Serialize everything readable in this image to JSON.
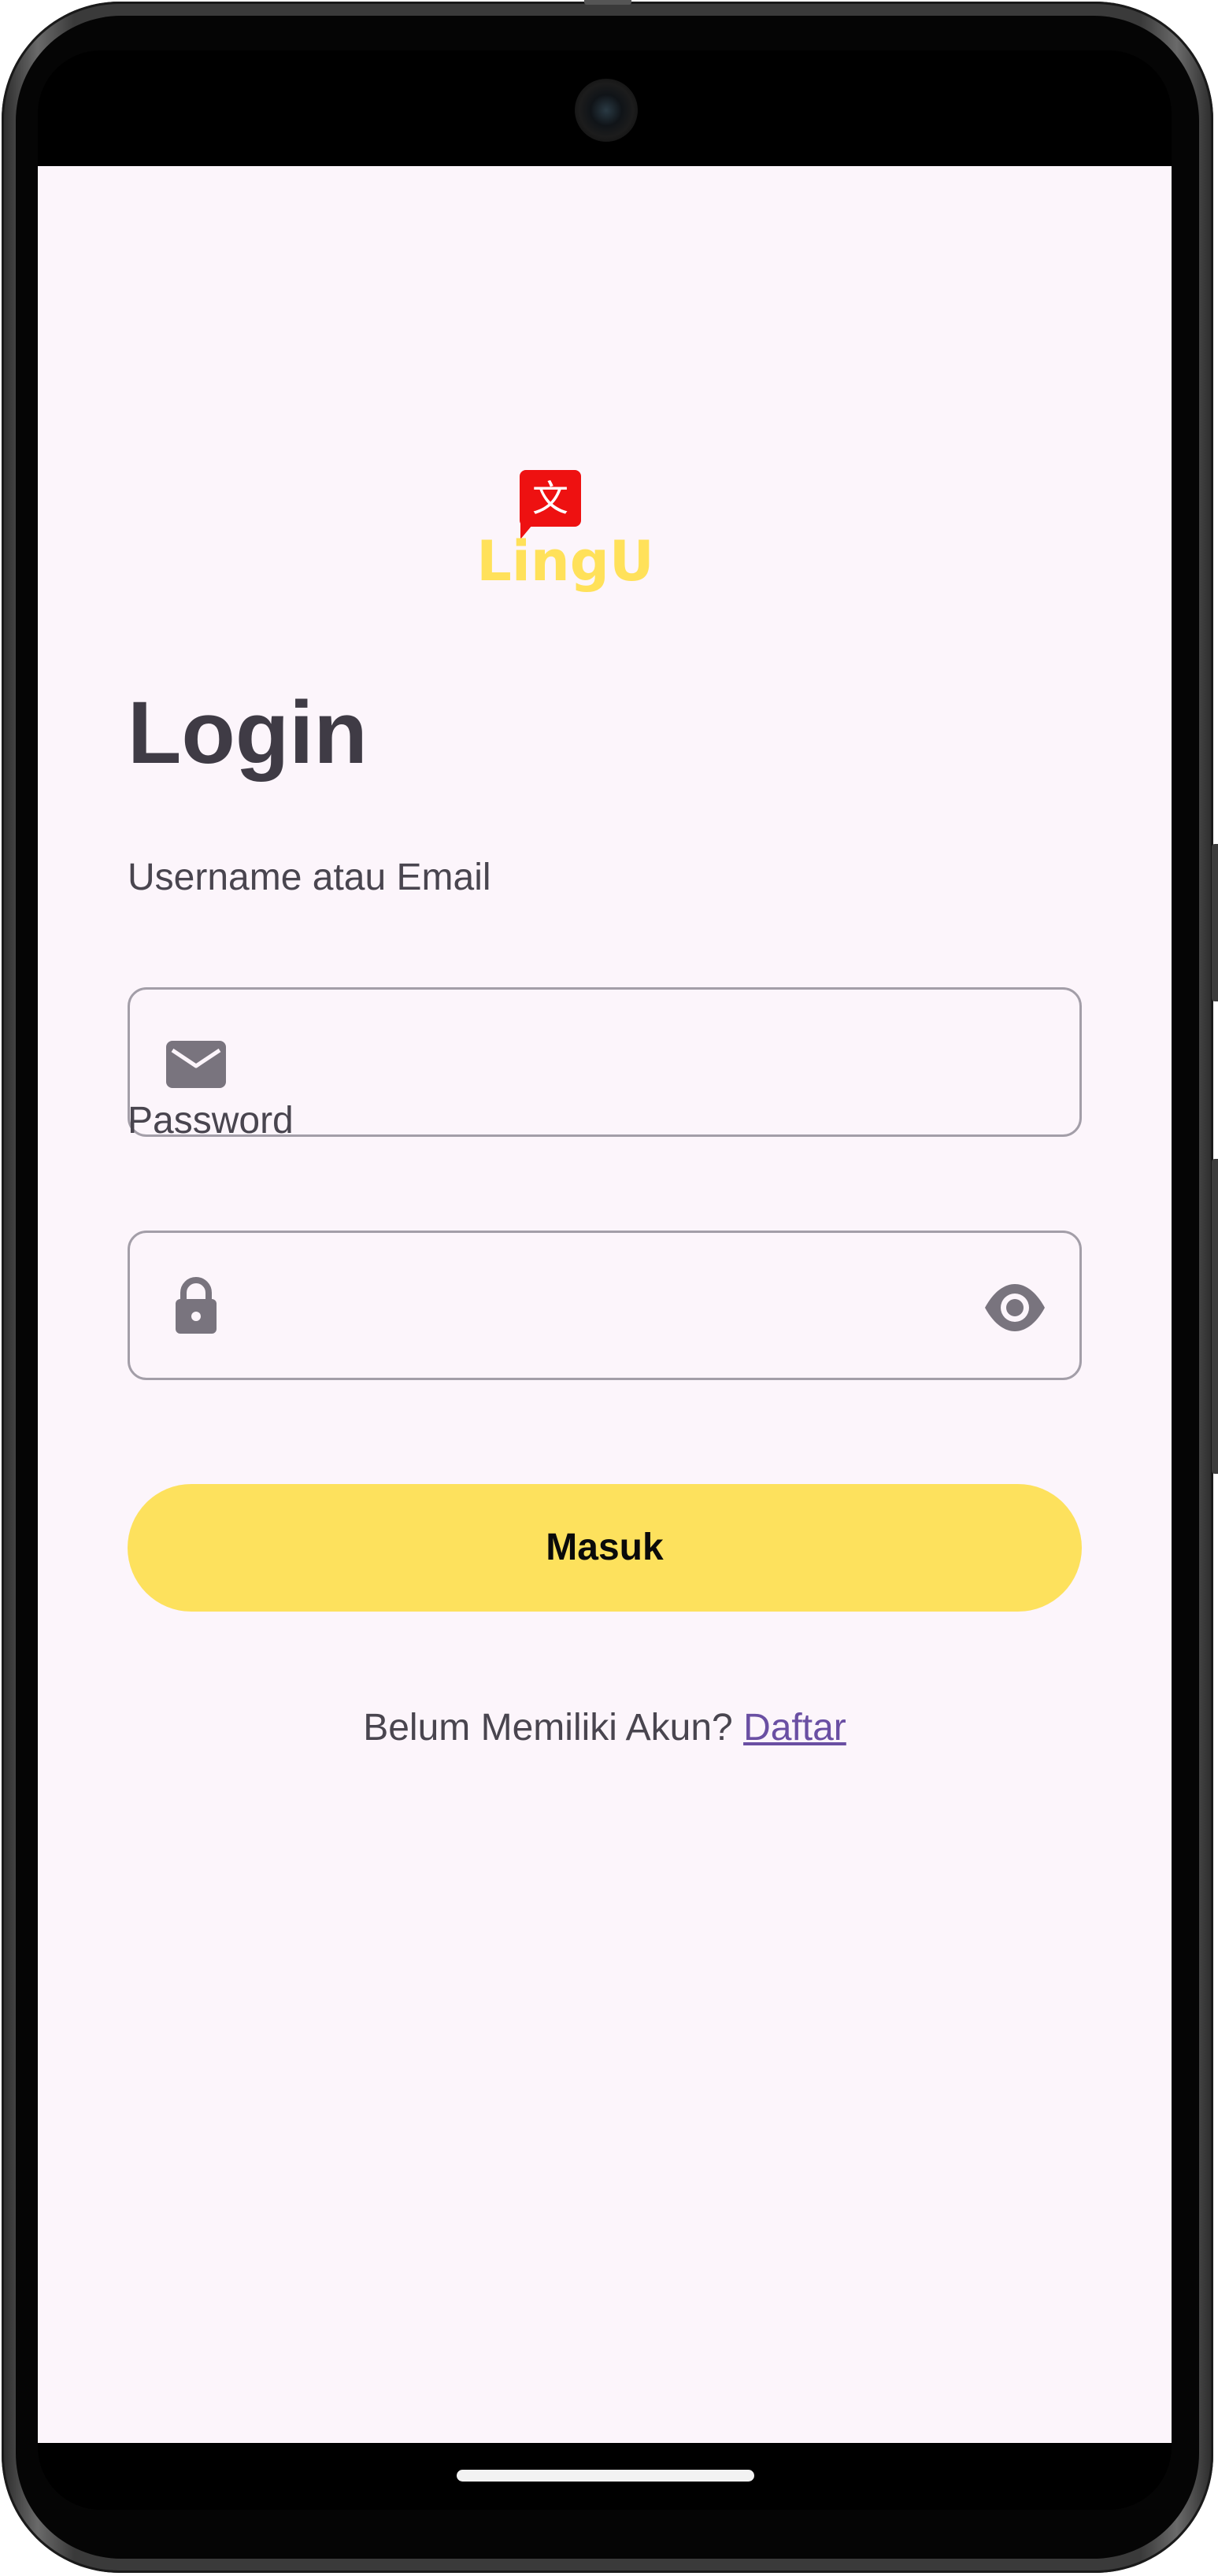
{
  "app": {
    "logo_glyph": "文",
    "logo_text": "LingU",
    "title": "Login"
  },
  "form": {
    "username_label": "Username atau Email",
    "username_value": "",
    "password_label": "Password",
    "password_value": "",
    "submit_label": "Masuk"
  },
  "footer": {
    "prompt": "Belum Memiliki Akun?",
    "link_label": "Daftar"
  },
  "icons": {
    "username_field": "mail-icon",
    "password_field": "lock-icon",
    "password_toggle": "eye-icon"
  },
  "colors": {
    "background": "#fcf5fb",
    "accent": "#fde15d",
    "logo_red": "#ee1111",
    "logo_text": "#ffe15a",
    "link": "#6a4fa3",
    "text": "#49454f"
  }
}
